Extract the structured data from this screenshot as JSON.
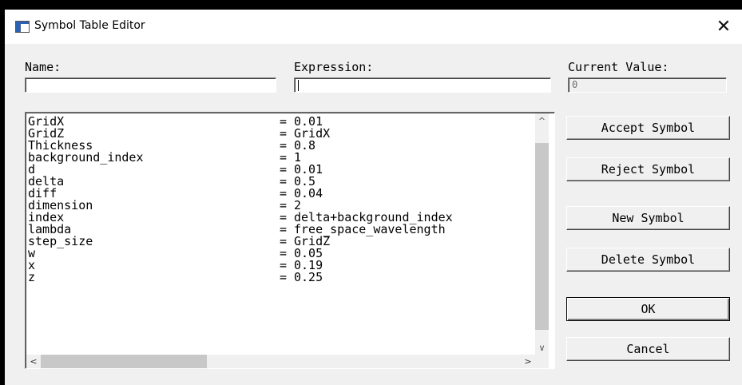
{
  "window": {
    "title": "Symbol Table Editor",
    "close_glyph": "✕",
    "icon": "app-window-icon"
  },
  "labels": {
    "name": "Name:",
    "expression": "Expression:",
    "current_value": "Current Value:"
  },
  "fields": {
    "name_value": "",
    "expression_value": "",
    "current_value": "0"
  },
  "symbols": [
    {
      "name": "GridX",
      "eq": "=",
      "value": "0.01"
    },
    {
      "name": "GridZ",
      "eq": "=",
      "value": "GridX"
    },
    {
      "name": "Thickness",
      "eq": "=",
      "value": "0.8"
    },
    {
      "name": "background_index",
      "eq": "=",
      "value": "1"
    },
    {
      "name": "d",
      "eq": "=",
      "value": "0.01"
    },
    {
      "name": "delta",
      "eq": "=",
      "value": "0.5"
    },
    {
      "name": "diff",
      "eq": "=",
      "value": "0.04"
    },
    {
      "name": "dimension",
      "eq": "=",
      "value": "2"
    },
    {
      "name": "index",
      "eq": "=",
      "value": "delta+background_index"
    },
    {
      "name": "lambda",
      "eq": "=",
      "value": "free_space_wavelength"
    },
    {
      "name": "step_size",
      "eq": "=",
      "value": "GridZ"
    },
    {
      "name": "w",
      "eq": "=",
      "value": "0.05"
    },
    {
      "name": "x",
      "eq": "=",
      "value": "0.19"
    },
    {
      "name": "z",
      "eq": "=",
      "value": "0.25"
    }
  ],
  "scroll": {
    "up": "^",
    "down": "∨",
    "left": "<",
    "right": ">"
  },
  "buttons": {
    "accept": "Accept Symbol",
    "reject": "Reject Symbol",
    "new": "New Symbol",
    "delete": "Delete Symbol",
    "ok": "OK",
    "cancel": "Cancel"
  }
}
